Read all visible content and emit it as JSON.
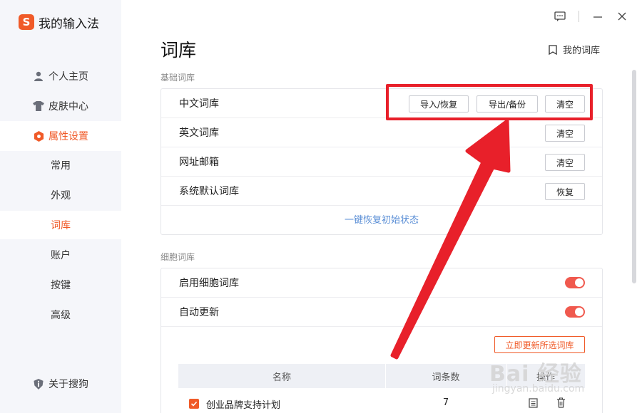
{
  "app": {
    "logo_letter": "S",
    "title": "我的输入法"
  },
  "sidebar": {
    "items": [
      {
        "label": "个人主页",
        "icon": "user-icon"
      },
      {
        "label": "皮肤中心",
        "icon": "shirt-icon"
      },
      {
        "label": "属性设置",
        "icon": "hexagon-settings-icon",
        "active": true
      }
    ],
    "sub_items": [
      {
        "label": "常用"
      },
      {
        "label": "外观"
      },
      {
        "label": "词库",
        "active": true
      },
      {
        "label": "账户"
      },
      {
        "label": "按键"
      },
      {
        "label": "高级"
      }
    ],
    "about_label": "关于搜狗"
  },
  "window_controls": [
    "feedback-icon",
    "minimize-icon",
    "close-icon"
  ],
  "page": {
    "title": "词库",
    "my_dict_label": "我的词库"
  },
  "basic_section": {
    "title": "基础词库",
    "rows": [
      {
        "label": "中文词库",
        "buttons": [
          "导入/恢复",
          "导出/备份",
          "清空"
        ]
      },
      {
        "label": "英文词库",
        "buttons": [
          "清空"
        ]
      },
      {
        "label": "网址邮箱",
        "buttons": [
          "清空"
        ]
      },
      {
        "label": "系统默认词库",
        "buttons": [
          "恢复"
        ]
      }
    ],
    "restore_all_label": "一键恢复初始状态"
  },
  "cell_section": {
    "title": "细胞词库",
    "rows": [
      {
        "label": "启用细胞词库",
        "toggle_on": true
      },
      {
        "label": "自动更新",
        "toggle_on": true
      }
    ],
    "update_button": "立即更新所选词库",
    "table": {
      "headers": [
        "名称",
        "词条数",
        "操作"
      ],
      "rows": [
        {
          "checked": true,
          "name": "创业品牌支持计划",
          "count": "7"
        }
      ]
    }
  },
  "watermark": {
    "brand": "Bai 经验",
    "url": "jingyan.baidu.com"
  },
  "colors": {
    "accent": "#f05a28",
    "toggle": "#f0594e",
    "annotation": "#e8202a",
    "link": "#5b8fd6"
  }
}
